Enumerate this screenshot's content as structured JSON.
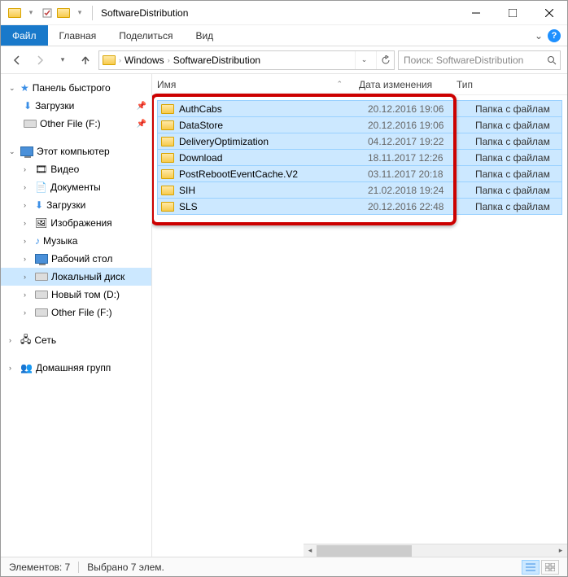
{
  "window": {
    "title": "SoftwareDistribution"
  },
  "ribbon": {
    "file": "Файл",
    "tabs": [
      "Главная",
      "Поделиться",
      "Вид"
    ]
  },
  "breadcrumb": {
    "items": [
      "Windows",
      "SoftwareDistribution"
    ]
  },
  "search": {
    "placeholder": "Поиск: SoftwareDistribution"
  },
  "sidebar": {
    "quick_access": "Панель быстрого",
    "quick_items": [
      {
        "label": "Загрузки",
        "pin": true
      },
      {
        "label": "Other File (F:)",
        "pin": true
      }
    ],
    "this_pc": "Этот компьютер",
    "pc_items": [
      "Видео",
      "Документы",
      "Загрузки",
      "Изображения",
      "Музыка",
      "Рабочий стол"
    ],
    "drives": [
      {
        "label": "Локальный диск",
        "selected": true
      },
      {
        "label": "Новый том (D:)"
      },
      {
        "label": "Other File (F:)"
      }
    ],
    "network": "Сеть",
    "homegroup": "Домашняя групп"
  },
  "columns": {
    "name": "Имя",
    "date": "Дата изменения",
    "type": "Тип"
  },
  "files": [
    {
      "name": "AuthCabs",
      "date": "20.12.2016 19:06",
      "type": "Папка с файлам"
    },
    {
      "name": "DataStore",
      "date": "20.12.2016 19:06",
      "type": "Папка с файлам"
    },
    {
      "name": "DeliveryOptimization",
      "date": "04.12.2017 19:22",
      "type": "Папка с файлам"
    },
    {
      "name": "Download",
      "date": "18.11.2017 12:26",
      "type": "Папка с файлам"
    },
    {
      "name": "PostRebootEventCache.V2",
      "date": "03.11.2017 20:18",
      "type": "Папка с файлам"
    },
    {
      "name": "SIH",
      "date": "21.02.2018 19:24",
      "type": "Папка с файлам"
    },
    {
      "name": "SLS",
      "date": "20.12.2016 22:48",
      "type": "Папка с файлам"
    }
  ],
  "status": {
    "count": "Элементов: 7",
    "selected": "Выбрано 7 элем."
  }
}
